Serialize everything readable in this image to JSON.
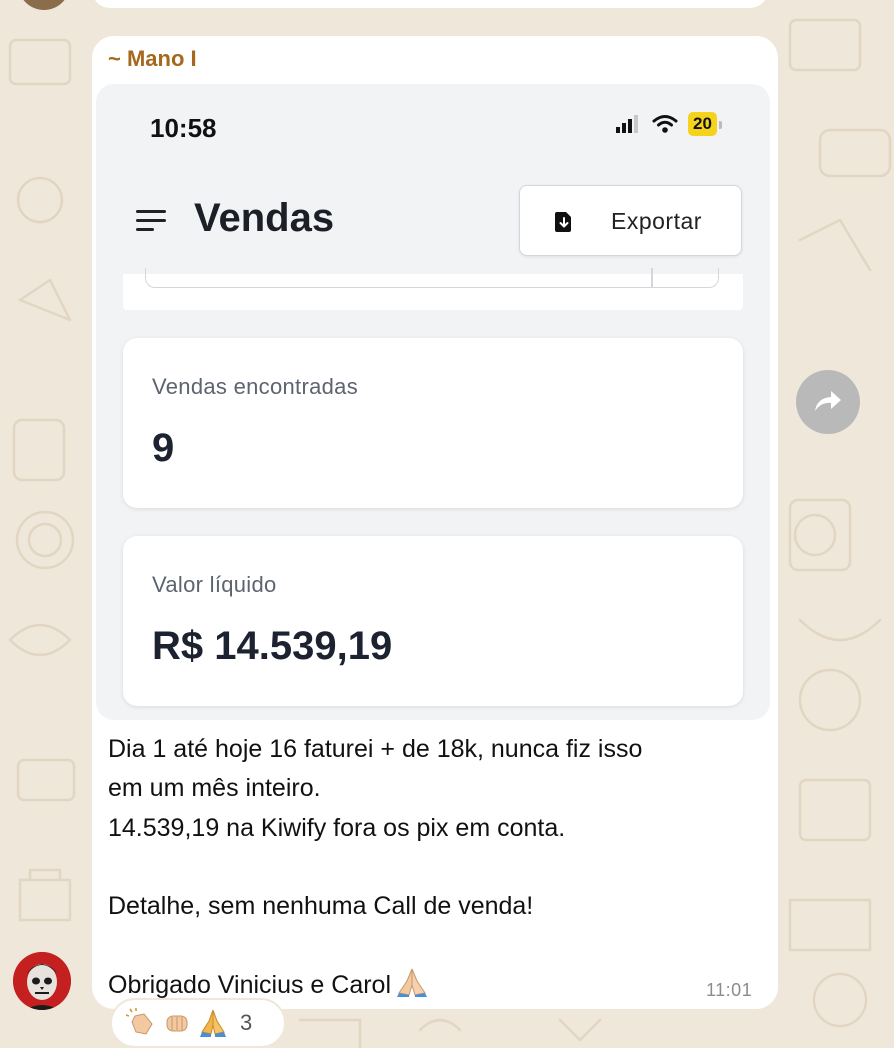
{
  "message": {
    "sender": "~ Mano I",
    "screenshot": {
      "status_time": "10:58",
      "battery": "20",
      "page_title": "Vendas",
      "export_label": "Exportar",
      "cards": [
        {
          "label": "Vendas encontradas",
          "value": "9"
        },
        {
          "label": "Valor líquido",
          "value": "R$ 14.539,19"
        }
      ]
    },
    "text_lines": [
      "Dia 1 até hoje 16 faturei + de 18k, nunca fiz isso",
      "em um mês inteiro.",
      "14.539,19 na Kiwify fora os pix em conta.",
      "",
      "Detalhe, sem nenhuma Call de venda!",
      "",
      "Obrigado Vinicius e Carol"
    ],
    "time": "11:01"
  },
  "reactions": {
    "emojis": [
      "clapping-hands",
      "fist-bump",
      "folded-hands"
    ],
    "count": "3"
  },
  "colors": {
    "wallpaper": "#efe7da",
    "sender_name": "#a5681c",
    "bubble": "#ffffff",
    "screenshot_bg": "#f2f3f5",
    "battery": "#f5d31d"
  }
}
